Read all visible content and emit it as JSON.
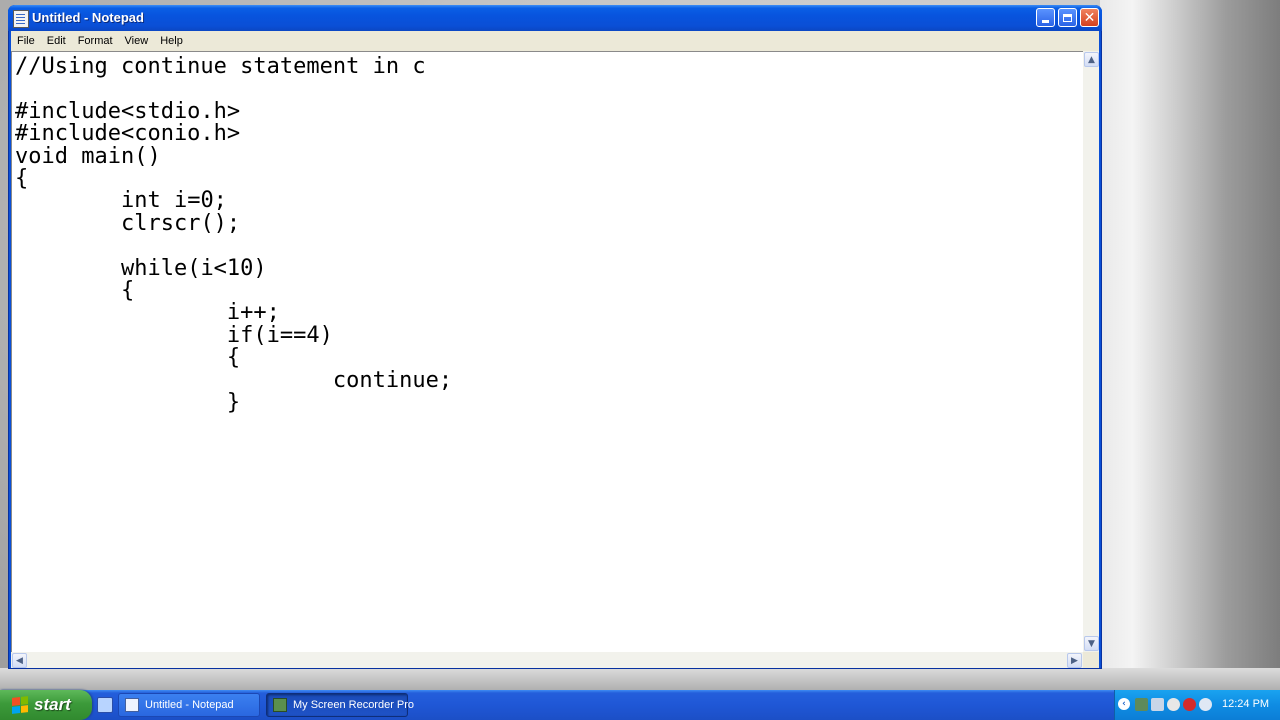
{
  "window": {
    "title": "Untitled - Notepad"
  },
  "menu": [
    "File",
    "Edit",
    "Format",
    "View",
    "Help"
  ],
  "editor": {
    "content": "//Using continue statement in c\n\n#include<stdio.h>\n#include<conio.h>\nvoid main()\n{\n\tint i=0;\n\tclrscr();\n\n\twhile(i<10)\n\t{\n\t\ti++;\n\t\tif(i==4)\n\t\t{\n\t\t\tcontinue;\n\t\t}"
  },
  "taskbar": {
    "start_label": "start",
    "tasks": [
      "Untitled - Notepad",
      "My Screen Recorder Pro"
    ],
    "clock": "12:24 PM"
  },
  "colors": {
    "titlebar": "#0a4fd6",
    "taskbar": "#245edb",
    "start_button": "#3c9a3a",
    "tray": "#0f8ce3"
  }
}
